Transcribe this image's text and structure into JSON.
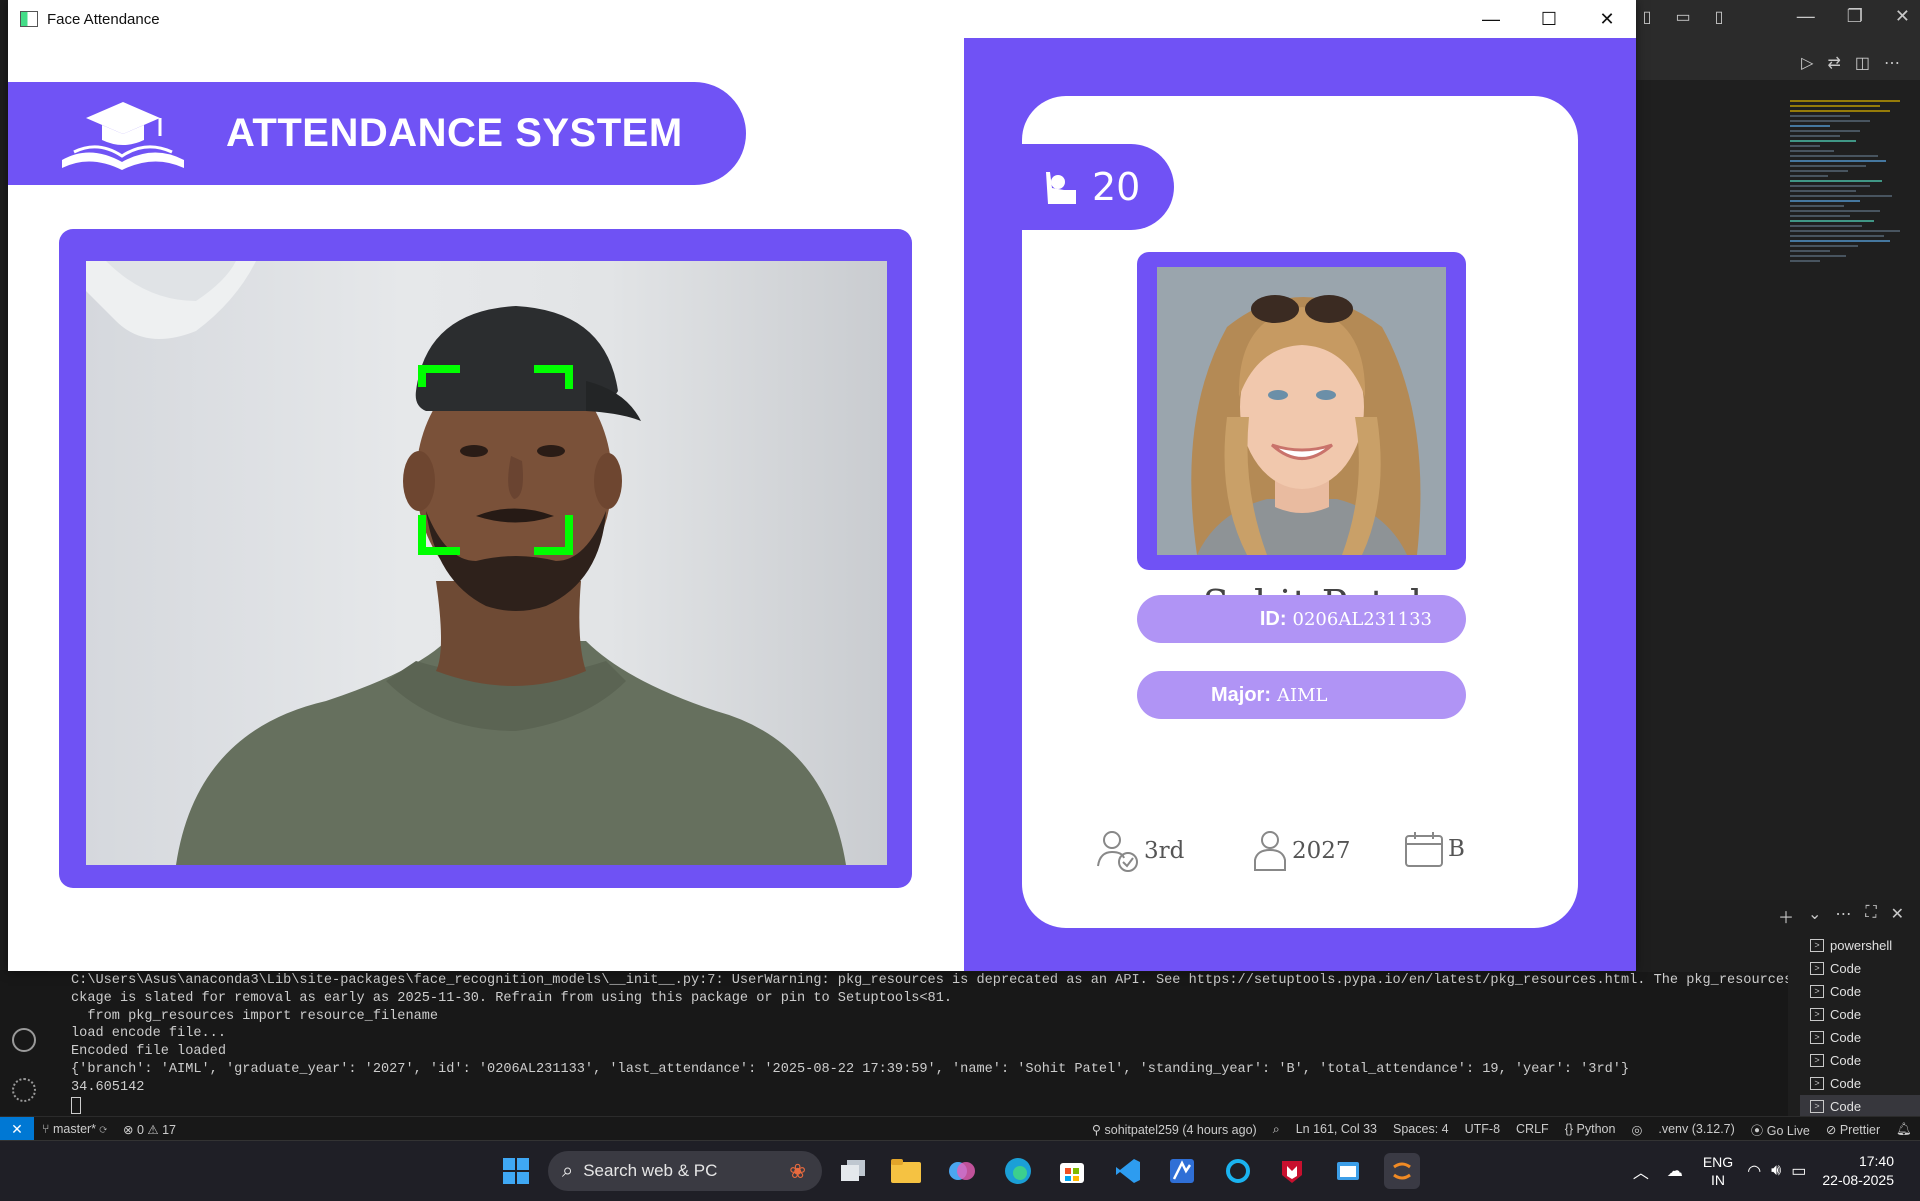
{
  "app_window": {
    "title": "Face Attendance",
    "window_buttons": {
      "minimize": "—",
      "maximize": "☐",
      "close": "✕"
    }
  },
  "left_pane": {
    "header_title": "ATTENDANCE SYSTEM"
  },
  "student_card": {
    "total_attendance": "20",
    "name": "Sohit Patel",
    "id_label": "ID:",
    "id_value": "0206AL231133",
    "major_label": "Major:",
    "major_value": "AIML",
    "year": "3rd",
    "graduate_year": "2027",
    "standing": "B"
  },
  "terminal": {
    "lines": [
      "C:\\Users\\Asus\\anaconda3\\Lib\\site-packages\\face_recognition_models\\__init__.py:7: UserWarning: pkg_resources is deprecated as an API. See https://setuptools.pypa.io/en/latest/pkg_resources.html. The pkg_resources pa",
      "ckage is slated for removal as early as 2025-11-30. Refrain from using this package or pin to Setuptools<81.",
      "  from pkg_resources import resource_filename",
      "load encode file...",
      "Encoded file loaded",
      "{'branch': 'AIML', 'graduate_year': '2027', 'id': '0206AL231133', 'last_attendance': '2025-08-22 17:39:59', 'name': 'Sohit Patel', 'standing_year': 'B', 'total_attendance': 19, 'year': '3rd'}",
      "34.605142"
    ]
  },
  "terminal_list": [
    "powershell",
    "Code",
    "Code",
    "Code",
    "Code",
    "Code",
    "Code",
    "Code"
  ],
  "statusbar": {
    "branch": "master*",
    "problems": "⊗ 0 ⚠ 17",
    "blame": "sohitpatel259 (4 hours ago)",
    "cursor": "Ln 161, Col 33",
    "spaces": "Spaces: 4",
    "encoding": "UTF-8",
    "eol": "CRLF",
    "language": "{} Python",
    "venv": ".venv (3.12.7)",
    "golive": "Go Live",
    "prettier": "Prettier"
  },
  "taskbar": {
    "search_placeholder": "Search web & PC",
    "lang_top": "ENG",
    "lang_bottom": "IN",
    "time": "17:40",
    "date": "22-08-2025"
  },
  "colors": {
    "brand_purple": "#7052f5",
    "pill_purple": "#b094f5",
    "face_box_green": "#00ff00"
  }
}
